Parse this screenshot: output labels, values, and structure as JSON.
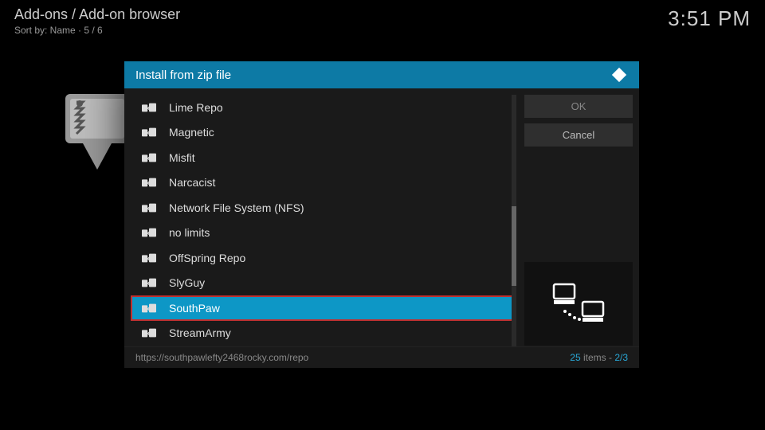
{
  "header": {
    "breadcrumb": "Add-ons / Add-on browser",
    "sort": "Sort by: Name  ·  5 / 6",
    "clock": "3:51 PM"
  },
  "dialog": {
    "title": "Install from zip file",
    "items": [
      {
        "label": "Lime Repo"
      },
      {
        "label": "Magnetic"
      },
      {
        "label": "Misfit"
      },
      {
        "label": "Narcacist"
      },
      {
        "label": "Network File System (NFS)"
      },
      {
        "label": "no limits"
      },
      {
        "label": "OffSpring Repo"
      },
      {
        "label": "SlyGuy"
      },
      {
        "label": "SouthPaw",
        "selected": true
      },
      {
        "label": "StreamArmy"
      }
    ],
    "buttons": {
      "ok": "OK",
      "cancel": "Cancel"
    },
    "footer": {
      "path": "https://southpawlefty2468rocky.com/repo",
      "count": "25",
      "count_label": "items",
      "page": "2/3"
    }
  }
}
